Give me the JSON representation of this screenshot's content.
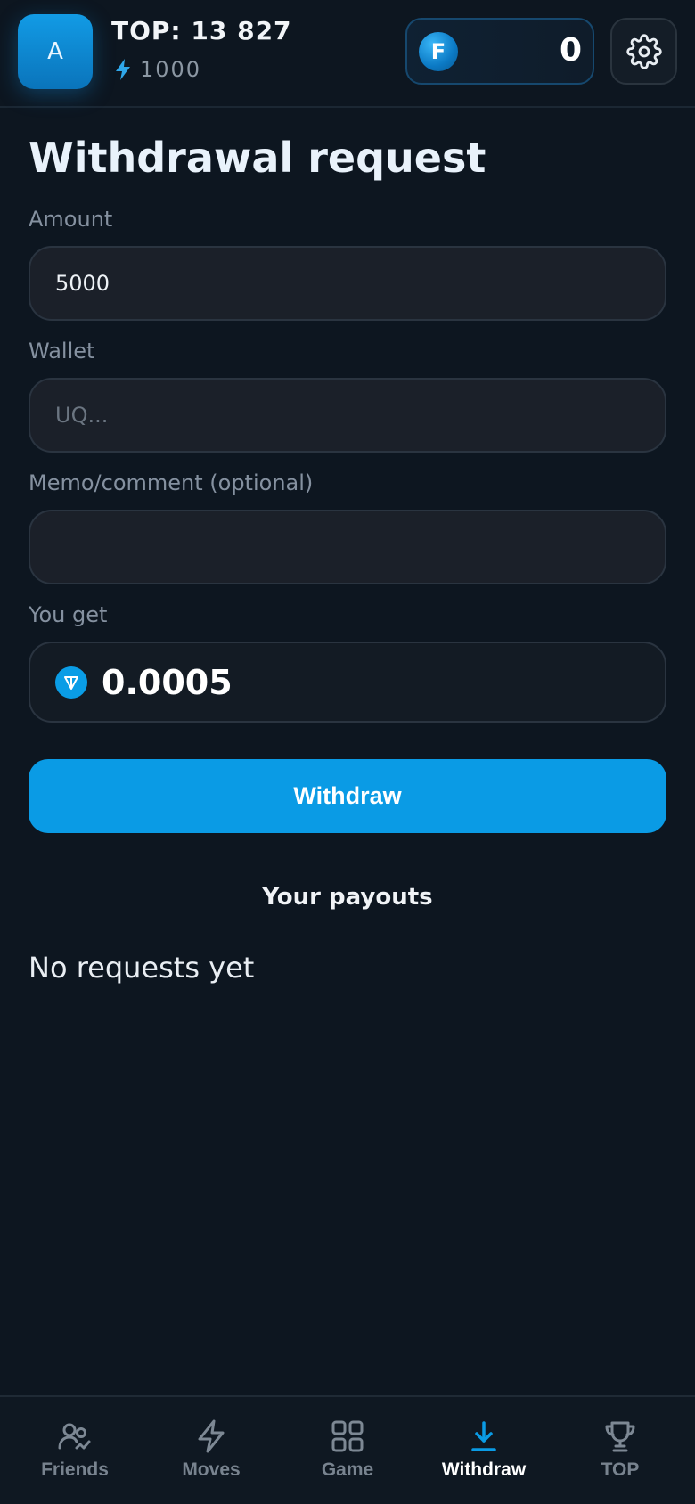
{
  "header": {
    "avatar_letter": "A",
    "top_label": "TOP: 13 827",
    "energy_value": "1000",
    "coin_letter": "F",
    "balance": "0",
    "icons": {
      "energy": "lightning-icon",
      "settings": "gear-icon"
    }
  },
  "form": {
    "title": "Withdrawal request",
    "amount_label": "Amount",
    "amount_value": "5000",
    "wallet_label": "Wallet",
    "wallet_placeholder": "UQ...",
    "memo_label": "Memo/comment (optional)",
    "memo_value": "",
    "you_get_label": "You get",
    "you_get_value": "0.0005",
    "withdraw_button": "Withdraw"
  },
  "payouts": {
    "title": "Your payouts",
    "empty_text": "No requests yet"
  },
  "nav": {
    "items": [
      {
        "label": "Friends",
        "icon": "friends-icon",
        "active": false
      },
      {
        "label": "Moves",
        "icon": "lightning-icon",
        "active": false
      },
      {
        "label": "Game",
        "icon": "grid-icon",
        "active": false
      },
      {
        "label": "Withdraw",
        "icon": "download-icon",
        "active": true
      },
      {
        "label": "TOP",
        "icon": "trophy-icon",
        "active": false
      }
    ]
  },
  "colors": {
    "background": "#0d1620",
    "accent": "#0a9be5",
    "muted_text": "#8591a0"
  }
}
